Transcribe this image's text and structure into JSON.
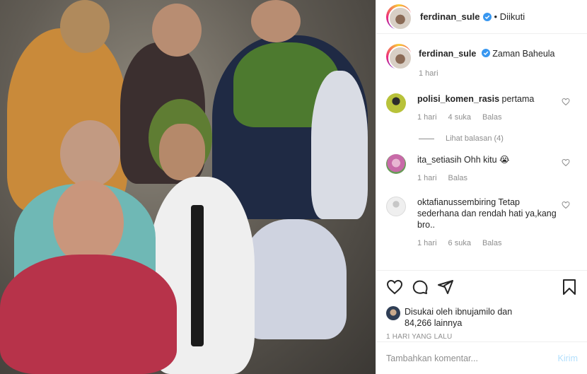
{
  "post": {
    "author": "ferdinan_sule",
    "follow_status": "• Diikuti",
    "caption_author": "ferdinan_sule",
    "caption_text": "Zaman Baheula",
    "caption_age": "1 hari"
  },
  "comments": [
    {
      "user": "polisi_komen_rasis",
      "text": "pertama",
      "age": "1 hari",
      "likes": "4 suka",
      "reply": "Balas",
      "avatar_color": "#b8c23a"
    },
    {
      "user": "ita_setiasih",
      "text": "Ohh kitu 😭",
      "age": "1 hari",
      "likes": "",
      "reply": "Balas",
      "avatar_color": "#c86aa8"
    },
    {
      "user": "oktafianussembiring",
      "text": "Tetap sederhana dan rendah hati ya,kang bro..",
      "age": "1 hari",
      "likes": "6 suka",
      "reply": "Balas",
      "avatar_color": "#dbdbdb"
    }
  ],
  "view_replies": "Lihat balasan (4)",
  "likes": {
    "line1": "Disukai oleh ibnujamilo dan",
    "line2": "84,266 lainnya"
  },
  "date": "1 HARI YANG LALU",
  "add_comment": {
    "placeholder": "Tambahkan komentar...",
    "post_label": "Kirim"
  },
  "icons": [
    "heart-icon",
    "comment-icon",
    "share-icon",
    "bookmark-icon",
    "verified-icon"
  ],
  "colors": {
    "verified": "#3897f0",
    "muted": "#8e8e8e",
    "post_disabled": "#b2dffc"
  }
}
